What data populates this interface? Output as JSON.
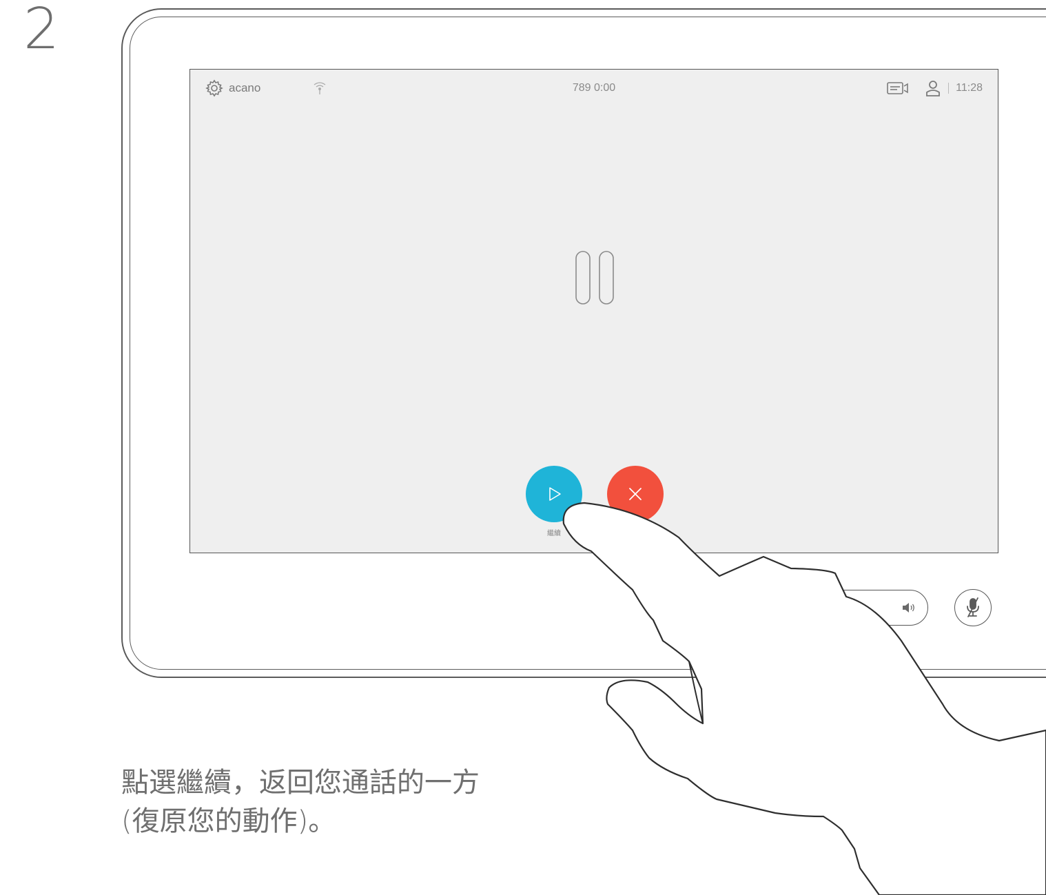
{
  "step": {
    "number": "2"
  },
  "device": {
    "status_bar": {
      "app_name": "acano",
      "call_info": "789 0:00",
      "clock": "11:28"
    },
    "call_controls": {
      "resume_label": "繼續",
      "resume_color": "#1fb4d8",
      "end_color": "#f2503d"
    },
    "icons": {
      "settings": "gear-icon",
      "signal": "wifi-icon",
      "camera": "camera-icon",
      "contacts": "person-icon",
      "hold": "pause-icon",
      "resume": "play-icon",
      "end": "close-icon",
      "volume": "speaker-icon",
      "mute": "microphone-muted-icon"
    }
  },
  "caption": {
    "line1": "點選繼續，返回您通話的一方",
    "line2": "(復原您的動作)。"
  }
}
